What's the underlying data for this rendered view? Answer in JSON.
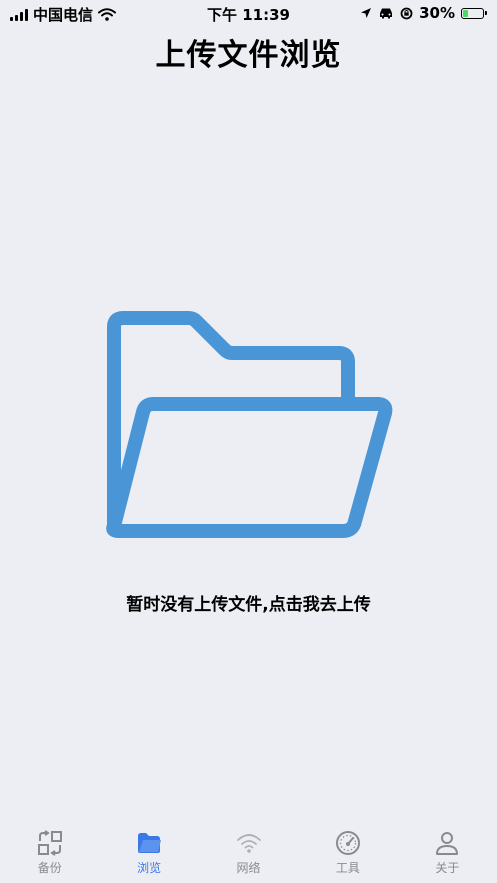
{
  "status_bar": {
    "carrier": "中国电信",
    "time": "下午 11:39",
    "battery_percent": "30%",
    "battery_level": 0.3,
    "icons": [
      "signal-icon",
      "wifi-icon",
      "location-icon",
      "car-icon",
      "rotation-lock-icon",
      "battery-icon"
    ]
  },
  "header": {
    "title": "上传文件浏览"
  },
  "empty_state": {
    "icon": "open-folder-icon",
    "message": "暂时没有上传文件,点击我去上传"
  },
  "tab_bar": {
    "active_index": 1,
    "tabs": [
      {
        "label": "备份",
        "icon": "backup-icon"
      },
      {
        "label": "浏览",
        "icon": "folder-icon"
      },
      {
        "label": "网络",
        "icon": "wifi-icon"
      },
      {
        "label": "工具",
        "icon": "gauge-icon"
      },
      {
        "label": "关于",
        "icon": "person-icon"
      }
    ]
  },
  "colors": {
    "accent": "#3b78e7",
    "folder_stroke": "#4a95d6",
    "background": "#eceef3",
    "inactive": "#8a8a8e"
  }
}
